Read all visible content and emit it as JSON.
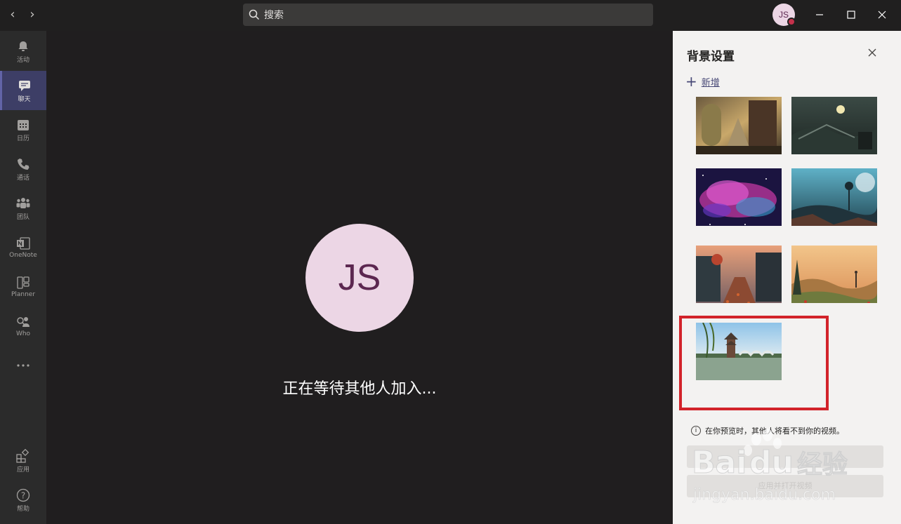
{
  "topbar": {
    "search_placeholder": "搜索",
    "user_initials": "JS"
  },
  "rail": {
    "items": [
      {
        "label": "活动",
        "icon": "bell-icon",
        "active": false
      },
      {
        "label": "聊天",
        "icon": "chat-icon",
        "active": true
      },
      {
        "label": "日历",
        "icon": "calendar-icon",
        "active": false
      },
      {
        "label": "通话",
        "icon": "phone-icon",
        "active": false
      },
      {
        "label": "团队",
        "icon": "teams-icon",
        "active": false
      },
      {
        "label": "OneNote",
        "icon": "onenote-icon",
        "active": false
      },
      {
        "label": "Planner",
        "icon": "planner-icon",
        "active": false
      },
      {
        "label": "Who",
        "icon": "who-icon",
        "active": false
      },
      {
        "label": "",
        "icon": "more-icon",
        "active": false
      }
    ],
    "bottom_items": [
      {
        "label": "应用",
        "icon": "apps-icon"
      },
      {
        "label": "帮助",
        "icon": "help-icon"
      }
    ]
  },
  "stage": {
    "avatar_initials": "JS",
    "waiting_text": "正在等待其他人加入..."
  },
  "panel": {
    "title": "背景设置",
    "add_label": "新增",
    "note": "在你预览时，其他人将看不到你的视频。",
    "button_apply": "应用并打开视频",
    "backgrounds": [
      {
        "name": "fantasy-alley"
      },
      {
        "name": "sci-fi-landscape"
      },
      {
        "name": "galaxy-nebula"
      },
      {
        "name": "alien-planet"
      },
      {
        "name": "autumn-street"
      },
      {
        "name": "orange-valley"
      },
      {
        "name": "pagoda-lake"
      }
    ]
  },
  "watermark": {
    "line1": "Baidu经验",
    "line2": "jingyan.baidu.com"
  },
  "colors": {
    "accent": "#6264a7",
    "highlight_box": "#d2232a",
    "avatar_bg": "#ecd6e5",
    "avatar_text": "#5c2750"
  }
}
